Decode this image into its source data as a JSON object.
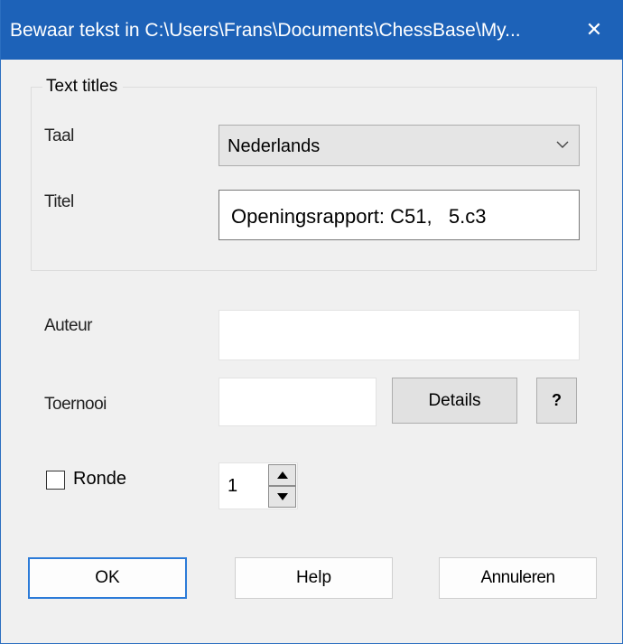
{
  "window": {
    "title": "Bewaar tekst in C:\\Users\\Frans\\Documents\\ChessBase\\My...",
    "close_glyph": "✕"
  },
  "text_titles": {
    "legend": "Text titles",
    "taal_label": "Taal",
    "taal_value": "Nederlands",
    "titel_label": "Titel",
    "titel_value": "Openingsrapport: C51,   5.c3"
  },
  "fields": {
    "auteur_label": "Auteur",
    "auteur_value": "",
    "toernooi_label": "Toernooi",
    "toernooi_value": "",
    "details_label": "Details",
    "help_q_label": "?",
    "ronde_label": "Ronde",
    "ronde_checked": false,
    "ronde_value": "1"
  },
  "buttons": {
    "ok": "OK",
    "help": "Help",
    "cancel": "Annuleren"
  },
  "colors": {
    "titlebar": "#1d62b8",
    "dialog_bg": "#f0f0f0",
    "default_button_border": "#2c7bd8"
  },
  "icons": {
    "close": "close-icon",
    "dropdown": "chevron-down-icon",
    "spin_up": "triangle-up-icon",
    "spin_down": "triangle-down-icon"
  }
}
